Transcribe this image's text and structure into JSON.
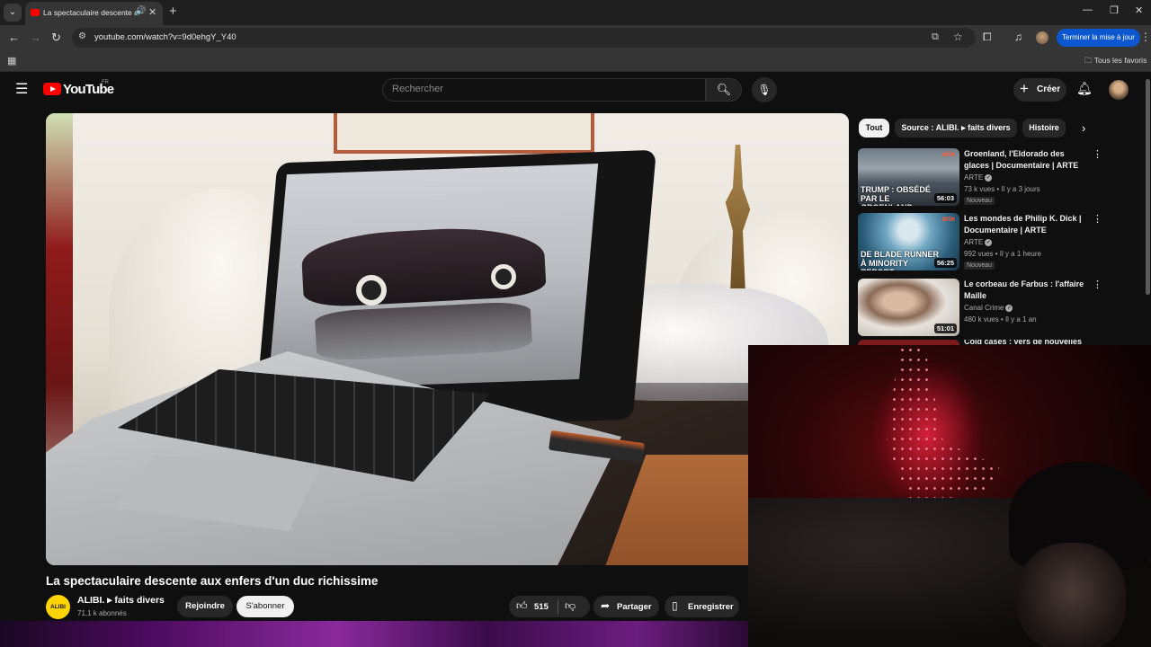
{
  "browser": {
    "tab_title": "La spectaculaire descente aux enfers d'un duc richissime - YouTube",
    "url": "youtube.com/watch?v=9d0ehgY_Y40",
    "update_button": "Terminer la mise à jour",
    "bookmarks_all": "Tous les favoris"
  },
  "masthead": {
    "logo_text": "YouTube",
    "country_code": "FR",
    "search_placeholder": "Rechercher",
    "create_label": "Créer"
  },
  "video": {
    "title": "La spectaculaire descente aux enfers d'un duc richissime",
    "channel_logo_text": "ALIBI",
    "channel_name": "ALIBI. ▸ faits divers",
    "subscribers": "71,1 k abonnés",
    "join_label": "Rejoindre",
    "subscribe_label": "S'abonner",
    "likes": "515",
    "share_label": "Partager",
    "save_label": "Enregistrer"
  },
  "chips": {
    "all": "Tout",
    "source": "Source : ALIBI. ▸ faits divers",
    "history": "Histoire"
  },
  "recommendations": [
    {
      "title": "Groenland, l'Eldorado des glaces | Documentaire | ARTE",
      "channel": "ARTE",
      "meta": "73 k vues • Il y a 3 jours",
      "badge": "Nouveau",
      "duration": "56:03",
      "thumb_caption": "TRUMP : OBSÉDÉ PAR LE GROENLAND",
      "thumb_brand": "arte"
    },
    {
      "title": "Les mondes de Philip K. Dick | Documentaire | ARTE",
      "channel": "ARTE",
      "meta": "992 vues • Il y a 1 heure",
      "badge": "Nouveau",
      "duration": "56:25",
      "thumb_caption": "DE BLADE RUNNER À MINORITY REPORT",
      "thumb_brand": "arte"
    },
    {
      "title": "Le corbeau de Farbus : l'affaire Maille",
      "channel": "Canal Crime",
      "meta": "480 k vues • Il y a 1 an",
      "duration": "51:01"
    },
    {
      "title": "Cold cases : vers de nouvelles"
    }
  ],
  "icons": {
    "tab_menu": "chevron-down-icon",
    "back": "arrow-left-icon",
    "forward": "arrow-right-icon",
    "reload": "reload-icon",
    "star": "star-icon",
    "bell": "bell-icon",
    "search": "search-icon",
    "mic": "mic-icon"
  },
  "colors": {
    "youtube_red": "#ff0000",
    "update_blue": "#0b57d0",
    "channel_yellow": "#ffd400"
  }
}
